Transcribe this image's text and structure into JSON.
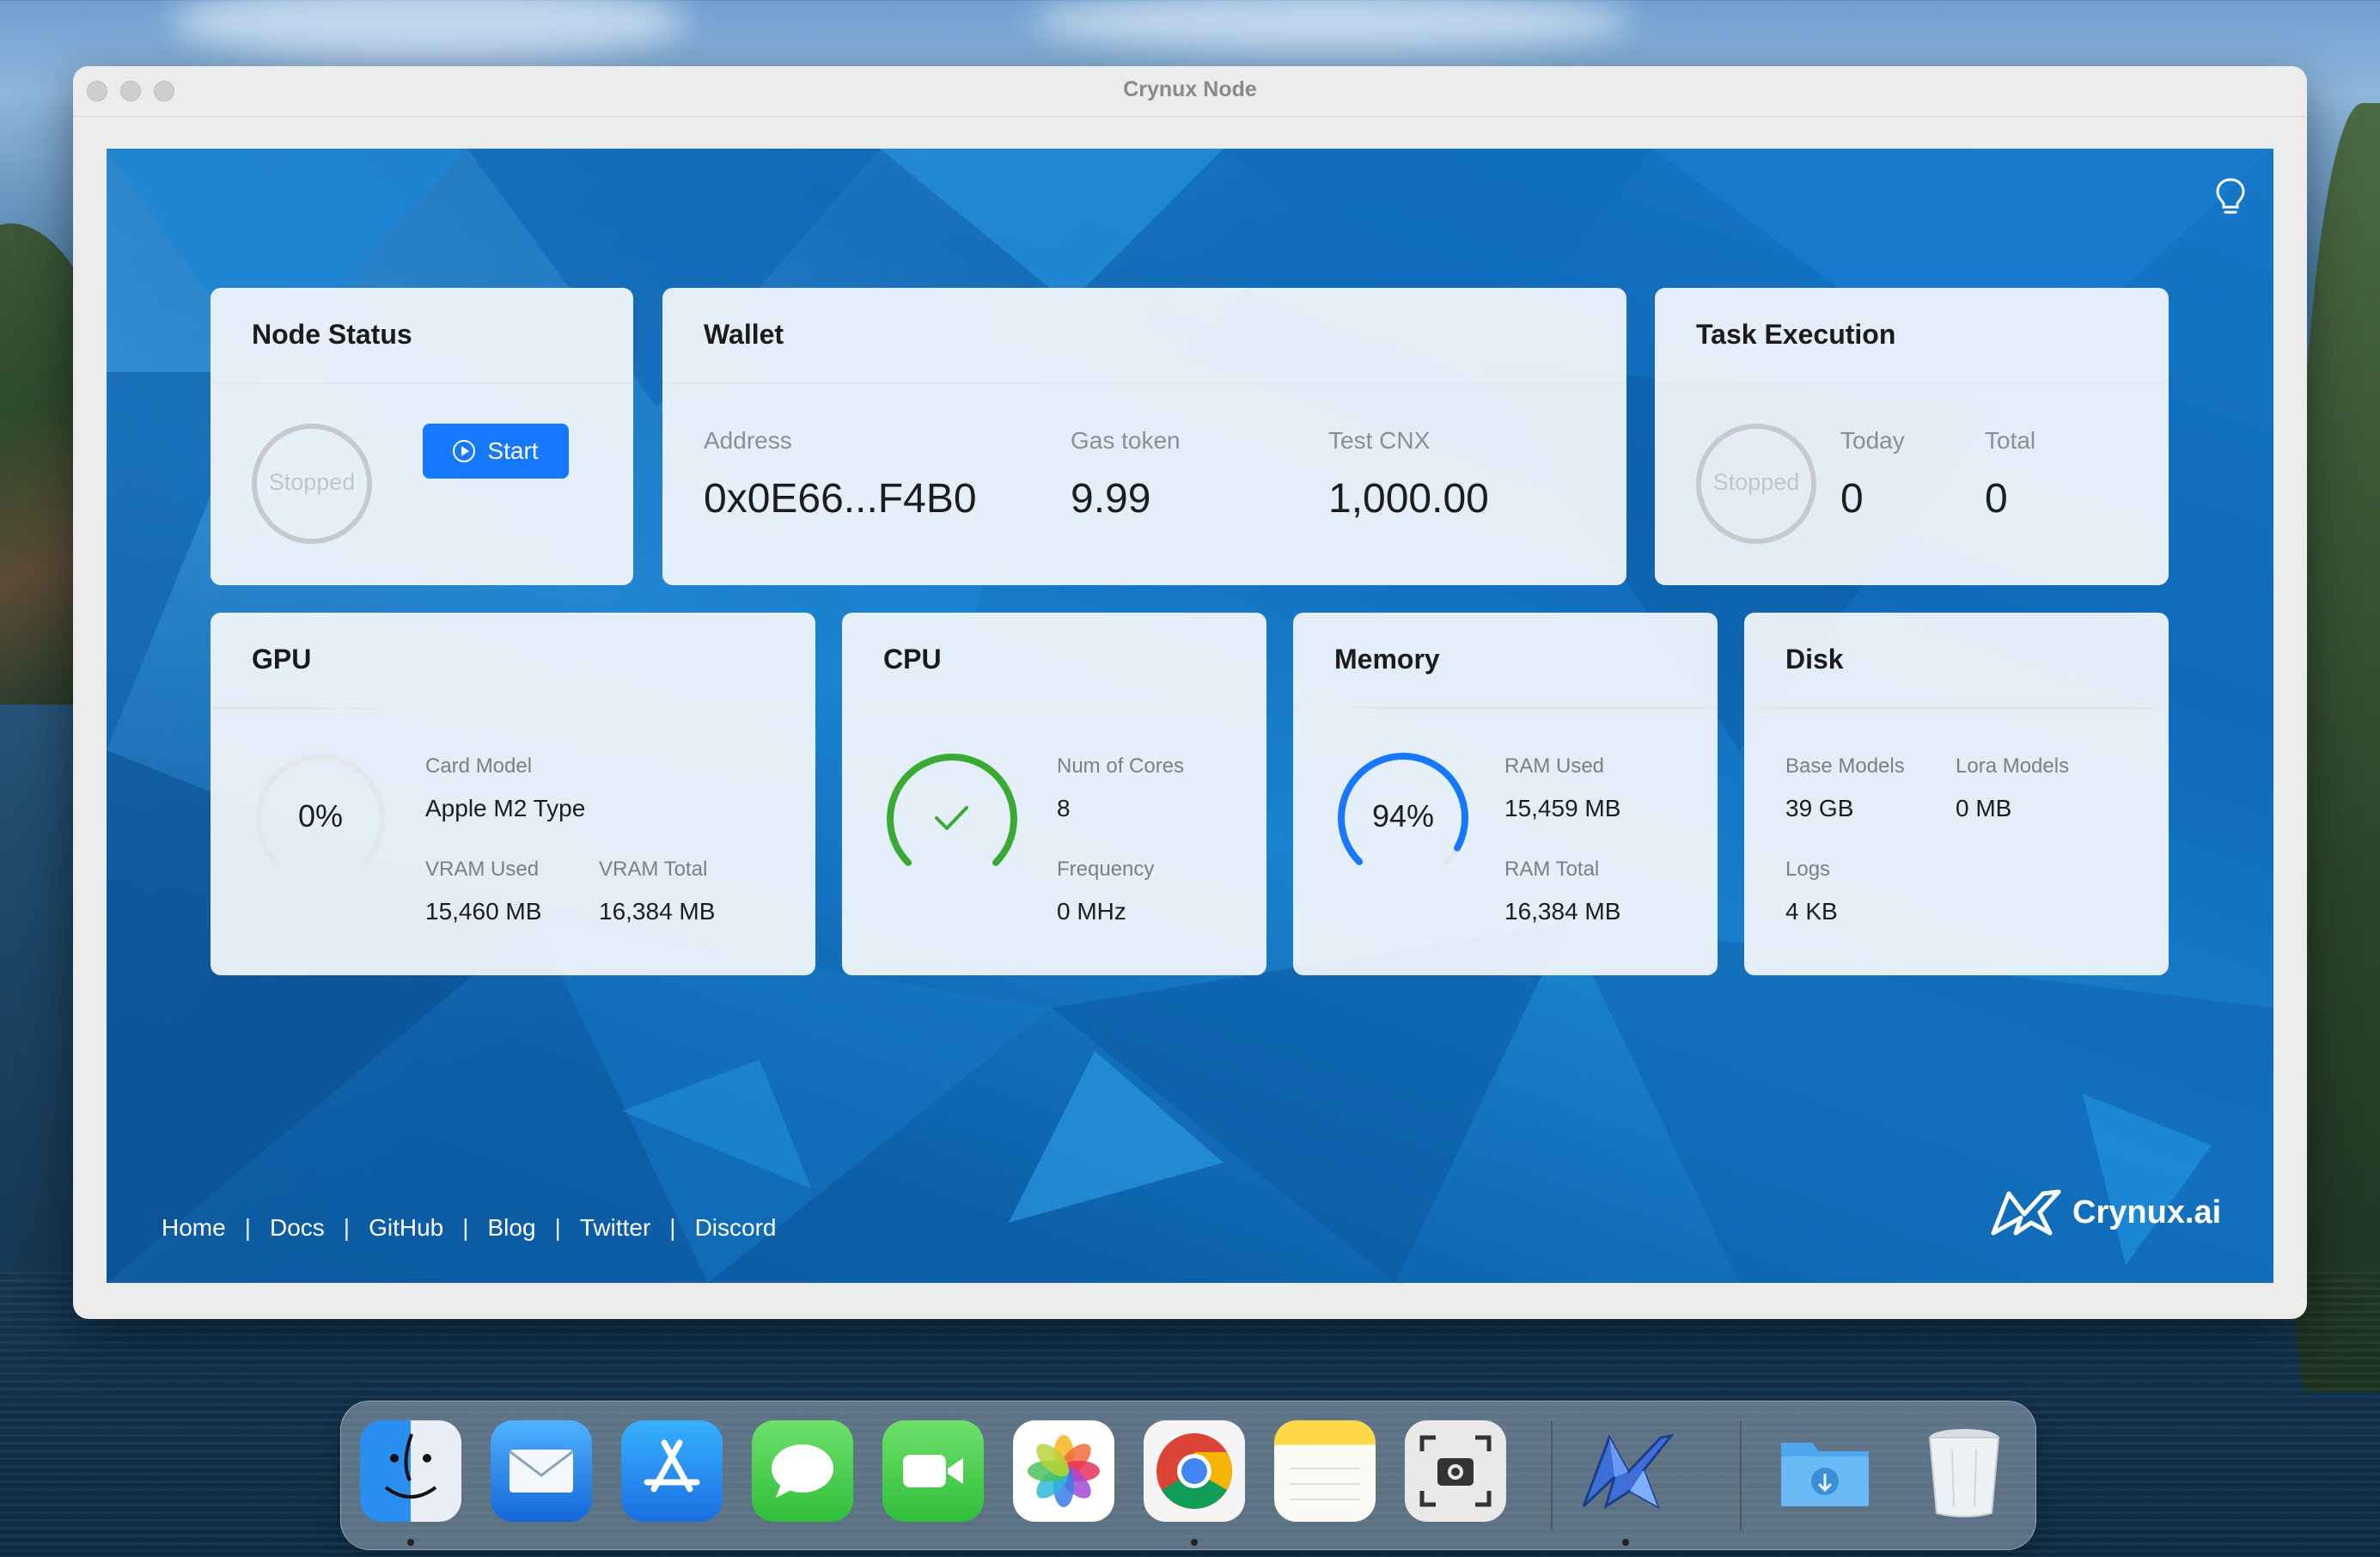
{
  "window": {
    "title": "Crynux Node"
  },
  "node_status": {
    "title": "Node Status",
    "status": "Stopped",
    "start_button": "Start"
  },
  "wallet": {
    "title": "Wallet",
    "address_label": "Address",
    "address_value": "0x0E66...F4B0",
    "gas_label": "Gas token",
    "gas_value": "9.99",
    "cnx_label": "Test CNX",
    "cnx_value": "1,000.00"
  },
  "task": {
    "title": "Task Execution",
    "status": "Stopped",
    "today_label": "Today",
    "today_value": "0",
    "total_label": "Total",
    "total_value": "0"
  },
  "gpu": {
    "title": "GPU",
    "usage_text": "0%",
    "usage_fraction": 0,
    "card_model_label": "Card Model",
    "card_model_value": "Apple M2 Type",
    "vram_used_label": "VRAM Used",
    "vram_used_value": "15,460 MB",
    "vram_total_label": "VRAM Total",
    "vram_total_value": "16,384 MB"
  },
  "cpu": {
    "title": "CPU",
    "status_icon": "check-icon",
    "cores_label": "Num of Cores",
    "cores_value": "8",
    "freq_label": "Frequency",
    "freq_value": "0 MHz"
  },
  "memory": {
    "title": "Memory",
    "usage_text": "94%",
    "usage_fraction": 0.94,
    "ram_used_label": "RAM Used",
    "ram_used_value": "15,459 MB",
    "ram_total_label": "RAM Total",
    "ram_total_value": "16,384 MB"
  },
  "disk": {
    "title": "Disk",
    "base_label": "Base Models",
    "base_value": "39 GB",
    "lora_label": "Lora Models",
    "lora_value": "0 MB",
    "logs_label": "Logs",
    "logs_value": "4 KB"
  },
  "footer": {
    "links": [
      "Home",
      "Docs",
      "GitHub",
      "Blog",
      "Twitter",
      "Discord"
    ],
    "separator": "|",
    "brand": "Crynux.ai"
  },
  "theme": {
    "accent": "#1677ff",
    "cpu_green": "#3aaa35",
    "gauge_blue": "#1677ff",
    "gauge_track": "#e3e6ea"
  },
  "dock": {
    "icons": [
      "finder-icon",
      "mail-icon",
      "app-store-icon",
      "messages-icon",
      "facetime-icon",
      "photos-icon",
      "chrome-icon",
      "notes-icon",
      "screenshot-icon",
      "crynux-icon",
      "downloads-folder-icon",
      "trash-icon"
    ]
  }
}
